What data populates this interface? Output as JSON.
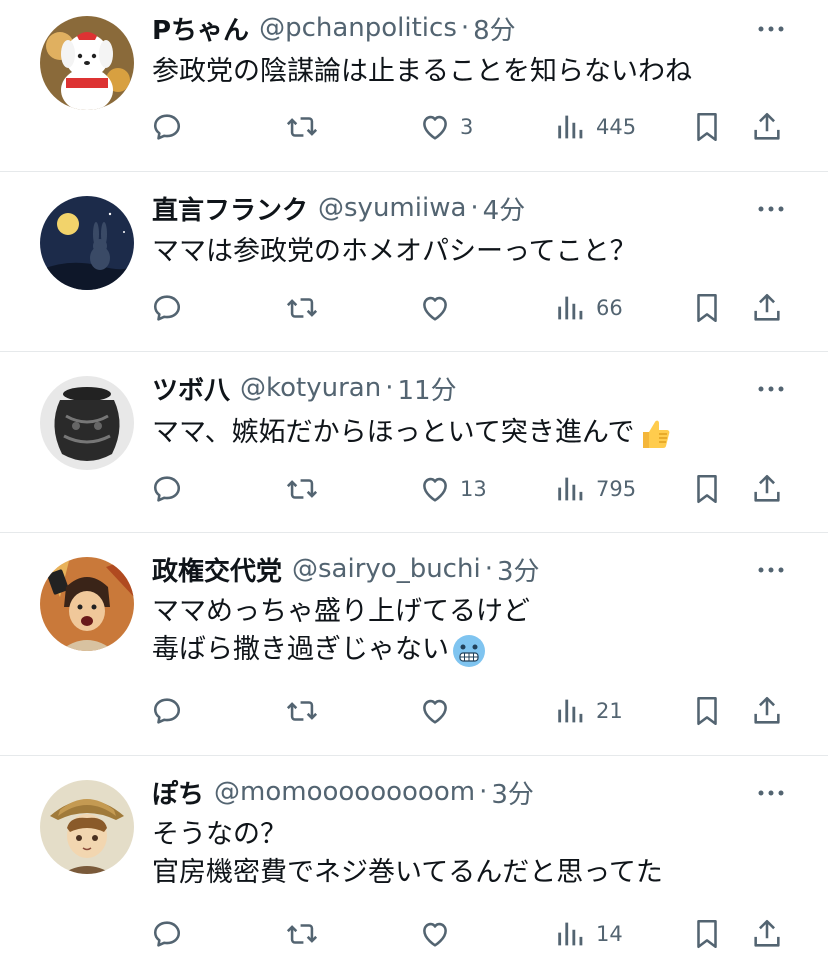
{
  "tweets": [
    {
      "name": "Pちゃん",
      "handle": "@pchanpolitics",
      "time": "8分",
      "lines": [
        "参政党の陰謀論は止まることを知らないわね"
      ],
      "likes": "3",
      "views": "445",
      "avatar_icon": "plush-doll-avatar"
    },
    {
      "name": "直言フランク",
      "handle": "@syumiiwa",
      "time": "4分",
      "lines": [
        "ママは参政党のホメオパシーってこと？"
      ],
      "likes": "",
      "views": "66",
      "avatar_icon": "rabbit-moon-avatar"
    },
    {
      "name": "ツボ八",
      "handle": "@kotyuran",
      "time": "11分",
      "lines": [
        "ママ、嫉妬だからほっといて突き進んで"
      ],
      "emoji": "thumbs-up-emoji",
      "likes": "13",
      "views": "795",
      "avatar_icon": "pot-avatar"
    },
    {
      "name": "政権交代党",
      "handle": "@sairyo_buchi",
      "time": "3分",
      "lines": [
        "ママめっちゃ盛り上げてるけど",
        "毒ばら撒き過ぎじゃない"
      ],
      "emoji": "cold-face-emoji",
      "likes": "",
      "views": "21",
      "avatar_icon": "comic-portrait-avatar"
    },
    {
      "name": "ぽち",
      "handle": "@momooooooooom",
      "time": "3分",
      "lines": [
        "そうなの？",
        "官房機密費でネジ巻いてるんだと思ってた"
      ],
      "likes": "",
      "views": "14",
      "avatar_icon": "anime-boy-avatar"
    }
  ],
  "separator": "·",
  "colors": {
    "text": "#0f1419",
    "secondary": "#536471",
    "divider": "#e6e9eb",
    "background": "#ffffff"
  }
}
